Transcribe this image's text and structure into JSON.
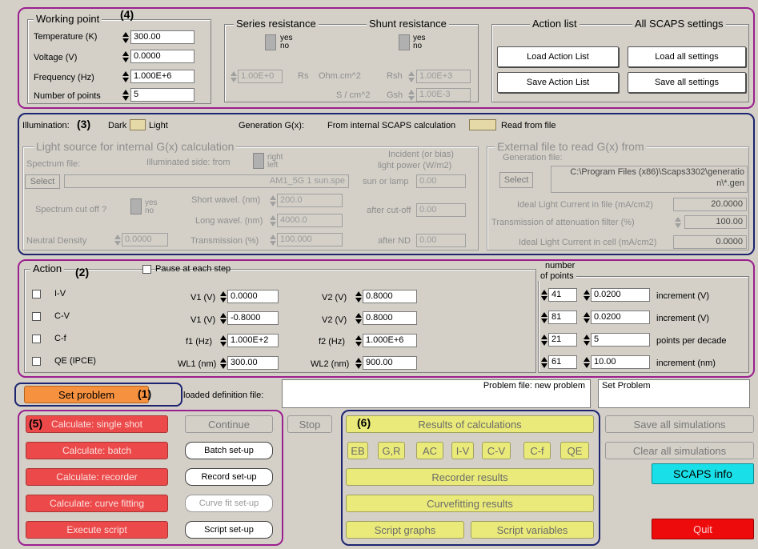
{
  "annotations": {
    "n1": "(1)",
    "n2": "(2)",
    "n3": "(3)",
    "n4": "(4)",
    "n5": "(5)",
    "n6": "(6)"
  },
  "working_point": {
    "title": "Working point",
    "temperature_label": "Temperature (K)",
    "temperature_value": "300.00",
    "voltage_label": "Voltage (V)",
    "voltage_value": "0.0000",
    "frequency_label": "Frequency (Hz)",
    "frequency_value": "1.000E+6",
    "points_label": "Number of points",
    "points_value": "5"
  },
  "series": {
    "title": "Series resistance",
    "yes": "yes",
    "no": "no",
    "value": "1.00E+0",
    "rs_label": "Rs",
    "unit1": "Ohm.cm^2",
    "unit2": "S / cm^2"
  },
  "shunt": {
    "title": "Shunt resistance",
    "yes": "yes",
    "no": "no",
    "rsh_label": "Rsh",
    "rsh_value": "1.00E+3",
    "gsh_label": "Gsh",
    "gsh_value": "1.00E-3"
  },
  "actions": {
    "title_left": "Action list",
    "title_right": "All SCAPS settings",
    "load_action": "Load Action List",
    "load_all": "Load all settings",
    "save_action": "Save Action List",
    "save_all": "Save all settings"
  },
  "illumination": {
    "label": "Illumination:",
    "dark": "Dark",
    "light": "Light",
    "gen_label": "Generation G(x):",
    "gen_internal": "From internal SCAPS calculation",
    "gen_file": "Read from file"
  },
  "light_source": {
    "title": "Light source for internal G(x) calculation",
    "spectrum_file": "Spectrum file:",
    "illuminated_side": "Illuminated side: from",
    "right": "right",
    "left": "left",
    "incident": "Incident (or bias)",
    "light_power": "light power (W/m2)",
    "select": "Select",
    "spectrum_value": "AM1_5G 1 sun.spe",
    "sun_or_lamp": "sun or lamp",
    "sun_value": "0.00",
    "cutoff_label": "Spectrum cut off ?",
    "yes": "yes",
    "no": "no",
    "short_label": "Short wavel. (nm)",
    "short_value": "200.0",
    "after_cutoff": "after cut-off",
    "after_cutoff_value": "0.00",
    "long_label": "Long wavel. (nm)",
    "long_value": "4000.0",
    "nd_label": "Neutral Density",
    "nd_value": "0.0000",
    "trans_label": "Transmission (%)",
    "trans_value": "100.000",
    "after_nd": "after ND",
    "after_nd_value": "0.00"
  },
  "external_file": {
    "title": "External file to read G(x) from",
    "gen_file": "Generation file:",
    "select": "Select",
    "path_line1": "C:\\Program Files (x86)\\Scaps3302\\generatio",
    "path_line2": "n\\*.gen",
    "ideal_file_label": "Ideal Light Current in file (mA/cm2)",
    "ideal_file_value": "20.0000",
    "atten_label": "Transmission of attenuation filter (%)",
    "atten_value": "100.00",
    "ideal_cell_label": "Ideal Light Current in cell (mA/cm2)",
    "ideal_cell_value": "0.0000"
  },
  "action": {
    "title": "Action",
    "pause": "Pause at each step",
    "number_of_points_1": "number",
    "number_of_points_2": "of points",
    "rows": [
      {
        "name": "I-V",
        "p1_label": "V1 (V)",
        "p1": "0.0000",
        "p2_label": "V2 (V)",
        "p2": "0.8000",
        "points": "41",
        "inc": "0.0200",
        "unit": "increment (V)"
      },
      {
        "name": "C-V",
        "p1_label": "V1 (V)",
        "p1": "-0.8000",
        "p2_label": "V2 (V)",
        "p2": "0.8000",
        "points": "81",
        "inc": "0.0200",
        "unit": "increment (V)"
      },
      {
        "name": "C-f",
        "p1_label": "f1 (Hz)",
        "p1": "1.000E+2",
        "p2_label": "f2 (Hz)",
        "p2": "1.000E+6",
        "points": "21",
        "inc": "5",
        "unit": "points per decade"
      },
      {
        "name": "QE (IPCE)",
        "p1_label": "WL1 (nm)",
        "p1": "300.00",
        "p2_label": "WL2 (nm)",
        "p2": "900.00",
        "points": "61",
        "inc": "10.00",
        "unit": "increment (nm)"
      }
    ]
  },
  "problem": {
    "set_problem": "Set problem",
    "loaded_label": "loaded definition file:",
    "problem_file": "Problem file: new problem",
    "status": "Set Problem"
  },
  "calc": {
    "single": "Calculate: single shot",
    "continue": "Continue",
    "stop": "Stop",
    "batch": "Calculate: batch",
    "batch_setup": "Batch set-up",
    "recorder": "Calculate: recorder",
    "record_setup": "Record set-up",
    "fitting": "Calculate: curve fitting",
    "fit_setup": "Curve fit set-up",
    "script": "Execute script",
    "script_setup": "Script set-up"
  },
  "results": {
    "title": "Results of calculations",
    "tabs": [
      "EB",
      "G,R",
      "AC",
      "I-V",
      "C-V",
      "C-f",
      "QE"
    ],
    "recorder": "Recorder results",
    "curvefit": "Curvefitting results",
    "script_graphs": "Script graphs",
    "script_vars": "Script variables"
  },
  "right_buttons": {
    "save_all": "Save all simulations",
    "clear_all": "Clear all simulations",
    "info": "SCAPS info",
    "quit": "Quit"
  },
  "colors": {
    "info": "#19e0e8",
    "quit": "#ee0b0b",
    "set_problem": "#f6913f",
    "red_button": "#ec4a4a",
    "yellow_button": "#eaea7a",
    "purple_frame": "#9b1f8f",
    "navy_frame": "#1d2470"
  }
}
